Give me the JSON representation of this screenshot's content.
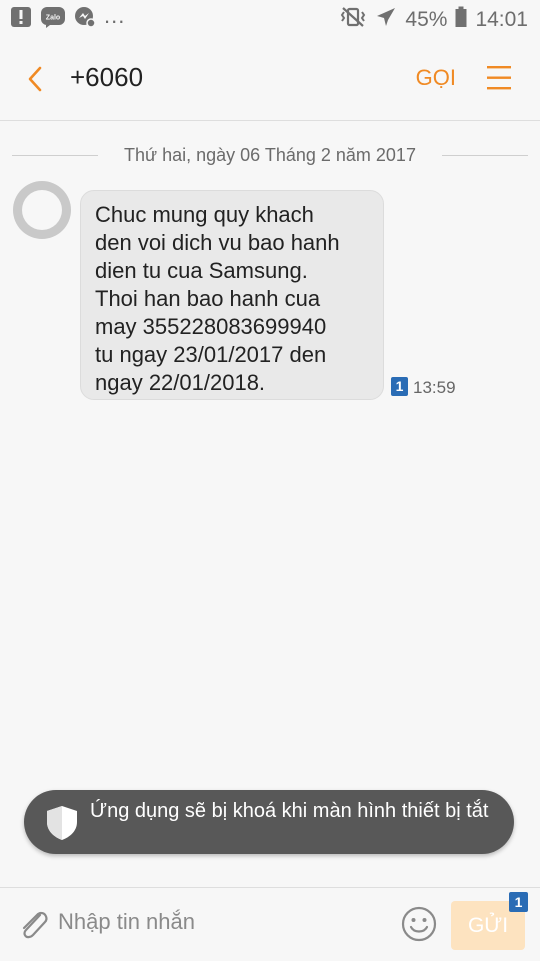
{
  "status_bar": {
    "more_indicator": "...",
    "battery_percent": "45%",
    "time": "14:01",
    "icons": [
      "alert-icon",
      "zalo-icon",
      "messenger-icon",
      "vibrate-icon",
      "airplane-mode-icon",
      "battery-icon"
    ],
    "zalo_label": "Zalo"
  },
  "header": {
    "contact": "+6060",
    "call_label": "GỌI",
    "accent_color": "#f08a24"
  },
  "conversation": {
    "date": "Thứ hai, ngày 06 Tháng 2 năm 2017",
    "messages": [
      {
        "text": "Chuc mung quy khach\nden voi dich vu bao hanh\ndien tu cua Samsung.\nThoi han bao hanh cua\nmay 355228083699940\ntu ngay 23/01/2017 den\nngay 22/01/2018.",
        "sim": "1",
        "time": "13:59"
      }
    ]
  },
  "toast": {
    "text": "Ứng dụng sẽ bị khoá khi màn hình thiết bị tắt"
  },
  "composer": {
    "placeholder": "Nhập tin nhắn",
    "send_label": "GỬI",
    "send_sim": "1",
    "sim_color": "#2a6cb5"
  }
}
